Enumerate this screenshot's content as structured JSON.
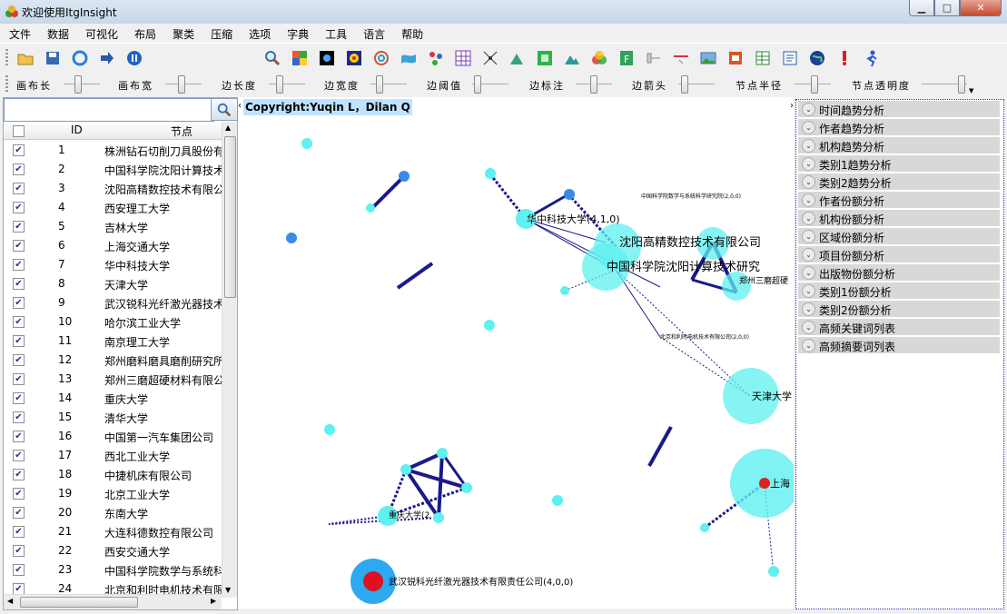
{
  "window": {
    "title": "欢迎使用ItgInsight"
  },
  "menu": [
    "文件",
    "数据",
    "可视化",
    "布局",
    "聚类",
    "压缩",
    "选项",
    "字典",
    "工具",
    "语言",
    "帮助"
  ],
  "sliders": [
    "画布长",
    "画布宽",
    "边长度",
    "边宽度",
    "边阈值",
    "边标注",
    "边箭头",
    "节点半径",
    "节点透明度"
  ],
  "grid": {
    "headers": {
      "id": "ID",
      "node": "节点"
    },
    "rows": [
      {
        "id": "1",
        "name": "株洲钻石切削刀具股份有"
      },
      {
        "id": "2",
        "name": "中国科学院沈阳计算技术"
      },
      {
        "id": "3",
        "name": "沈阳高精数控技术有限公"
      },
      {
        "id": "4",
        "name": "西安理工大学"
      },
      {
        "id": "5",
        "name": "吉林大学"
      },
      {
        "id": "6",
        "name": "上海交通大学"
      },
      {
        "id": "7",
        "name": "华中科技大学"
      },
      {
        "id": "8",
        "name": "天津大学"
      },
      {
        "id": "9",
        "name": "武汉锐科光纤激光器技术"
      },
      {
        "id": "10",
        "name": "哈尔滨工业大学"
      },
      {
        "id": "11",
        "name": "南京理工大学"
      },
      {
        "id": "12",
        "name": "郑州磨料磨具磨削研究所"
      },
      {
        "id": "13",
        "name": "郑州三磨超硬材料有限公"
      },
      {
        "id": "14",
        "name": "重庆大学"
      },
      {
        "id": "15",
        "name": "清华大学"
      },
      {
        "id": "16",
        "name": "中国第一汽车集团公司"
      },
      {
        "id": "17",
        "name": "西北工业大学"
      },
      {
        "id": "18",
        "name": "中捷机床有限公司"
      },
      {
        "id": "19",
        "name": "北京工业大学"
      },
      {
        "id": "20",
        "name": "东南大学"
      },
      {
        "id": "21",
        "name": "大连科德数控有限公司"
      },
      {
        "id": "22",
        "name": "西安交通大学"
      },
      {
        "id": "23",
        "name": "中国科学院数学与系统科"
      },
      {
        "id": "24",
        "name": "北京和利时电机技术有限"
      }
    ]
  },
  "graph": {
    "copyright": "Copyright:Yuqin L，Dilan Q",
    "labels": [
      "沈阳高精数控技术有限公司",
      "中国科学院沈阳计算技术研究",
      "华中科技大学(4,1,0)",
      "天津大学",
      "上海",
      "武汉锐科光纤激光器技术有限责任公司(4,0,0)",
      "郑州三磨超硬",
      "中国科学院数学与系统科学研究院(2,0,0)",
      "北京和利时电机技术有限公司(2,0,0)",
      "重庆大学(2"
    ]
  },
  "analysis": [
    "时间趋势分析",
    "作者趋势分析",
    "机构趋势分析",
    "类别1趋势分析",
    "类别2趋势分析",
    "作者份额分析",
    "机构份额分析",
    "区域份额分析",
    "项目份额分析",
    "出版物份额分析",
    "类别1份额分析",
    "类别2份额分析",
    "高频关键词列表",
    "高频摘要词列表"
  ]
}
